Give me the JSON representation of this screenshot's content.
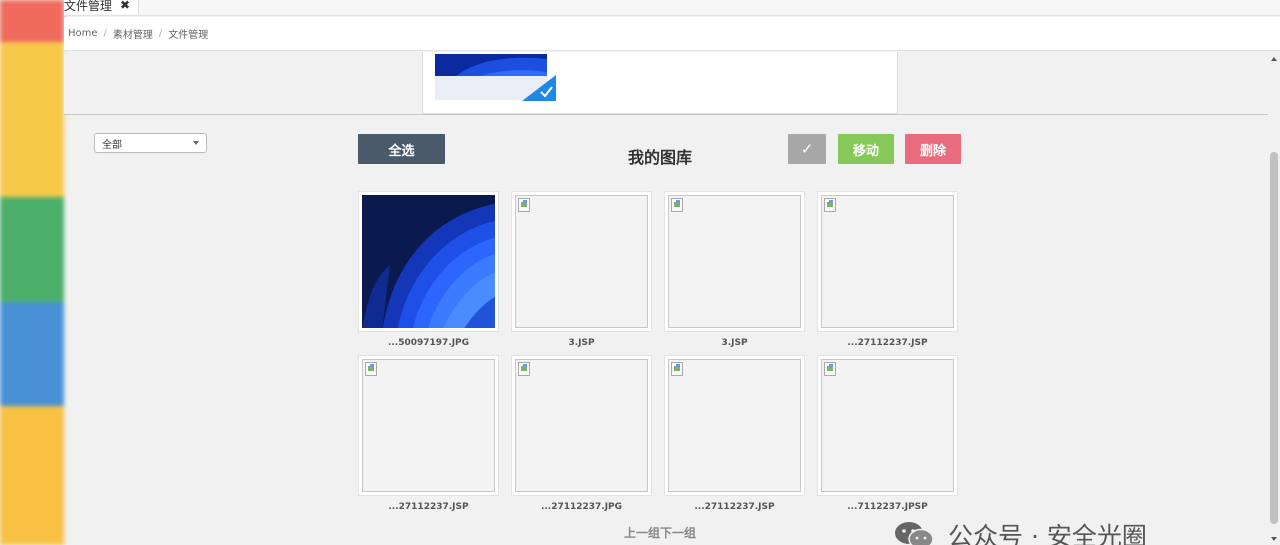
{
  "tabbar": {
    "tab_label": "文件管理",
    "close_glyph": "✖"
  },
  "breadcrumb": {
    "items": [
      "Home",
      "素材管理",
      "文件管理"
    ],
    "separator": "/"
  },
  "filter": {
    "selected": "全部"
  },
  "toolbar": {
    "select_all": "全选",
    "title": "我的图库",
    "confirm_glyph": "✓",
    "move": "移动",
    "delete": "删除"
  },
  "grid": {
    "items": [
      {
        "caption": "...50097197.JPG",
        "has_image": true
      },
      {
        "caption": "3.JSP",
        "has_image": false
      },
      {
        "caption": "3.JSP",
        "has_image": false
      },
      {
        "caption": "...27112237.JSP",
        "has_image": false
      },
      {
        "caption": "...27112237.JSP",
        "has_image": false
      },
      {
        "caption": "...27112237.JPG",
        "has_image": false
      },
      {
        "caption": "...27112237.JSP",
        "has_image": false
      },
      {
        "caption": "...7112237.JPSP",
        "has_image": false
      }
    ]
  },
  "pagination": {
    "prev": "上一组",
    "next": "下一组"
  },
  "watermark": {
    "text": "公众号 · 安全光圈"
  },
  "colors": {
    "select_all_bg": "#4a5a6a",
    "confirm_bg": "#a7a7a7",
    "move_bg": "#86c95a",
    "delete_bg": "#e86c7d",
    "check_badge": "#1e88e5"
  }
}
